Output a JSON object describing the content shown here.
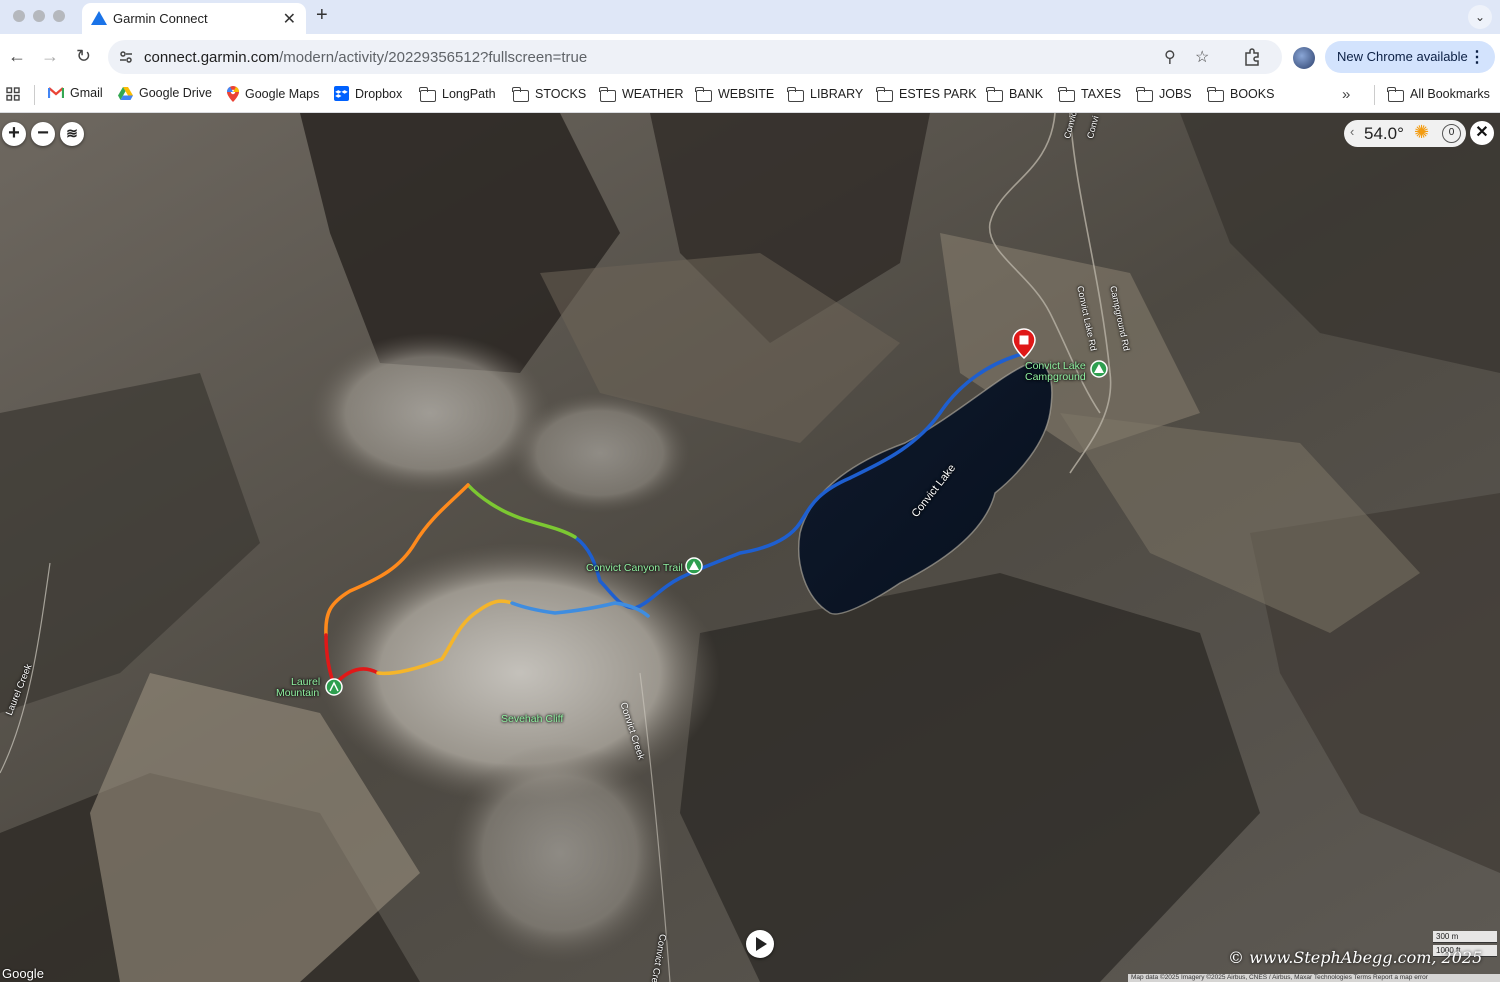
{
  "browser": {
    "tab": {
      "title": "Garmin Connect"
    },
    "url": {
      "host": "connect.garmin.com",
      "path": "/modern/activity/20229356512?fullscreen=true"
    },
    "update_label": "New Chrome available",
    "bookmarks": [
      {
        "label": "Gmail",
        "icon": "gmail-icon"
      },
      {
        "label": "Google Drive",
        "icon": "google-drive-icon"
      },
      {
        "label": "Google Maps",
        "icon": "google-maps-icon"
      },
      {
        "label": "Dropbox",
        "icon": "dropbox-icon"
      },
      {
        "label": "LongPath",
        "icon": "folder-icon"
      },
      {
        "label": "STOCKS",
        "icon": "folder-icon"
      },
      {
        "label": "WEATHER",
        "icon": "folder-icon"
      },
      {
        "label": "WEBSITE",
        "icon": "folder-icon"
      },
      {
        "label": "LIBRARY",
        "icon": "folder-icon"
      },
      {
        "label": "ESTES PARK",
        "icon": "folder-icon"
      },
      {
        "label": "BANK",
        "icon": "folder-icon"
      },
      {
        "label": "TAXES",
        "icon": "folder-icon"
      },
      {
        "label": "JOBS",
        "icon": "folder-icon"
      },
      {
        "label": "BOOKS",
        "icon": "folder-icon"
      }
    ],
    "all_bookmarks_label": "All Bookmarks"
  },
  "map": {
    "weather": {
      "temperature": "54.0°",
      "wind": "0",
      "icon": "sun-icon"
    },
    "labels": {
      "convict_lake": "Convict Lake",
      "campground_line1": "Convict Lake",
      "campground_line2": "Campground",
      "convict_canyon_trail": "Convict Canyon Trail",
      "laurel_line1": "Laurel",
      "laurel_line2": "Mountain",
      "sevehah_cliff": "Sevehah Cliff",
      "convict_creek": "Convict Creek",
      "convict_creek_lower": "Convict Creek",
      "laurel_creek": "Laurel Creek",
      "campground_rd": "Campground Rd",
      "convict_lake_rd": "Convict Lake Rd",
      "convict_top1": "Convict",
      "convict_top2": "Convi"
    },
    "scale": {
      "metric": "300 m",
      "imperial": "1000 ft"
    },
    "google_logo": "Google",
    "copyright": "© www.StephAbegg.com, 2025",
    "attribution": "Map data ©2025 Imagery ©2025 Airbus, CNES / Airbus, Maxar Technologies   Terms   Report a map error",
    "route_colors": {
      "start": "#1e5fd0",
      "mid": "#7cc832",
      "high": "#ff8a1c",
      "summit": "#e01818"
    }
  }
}
